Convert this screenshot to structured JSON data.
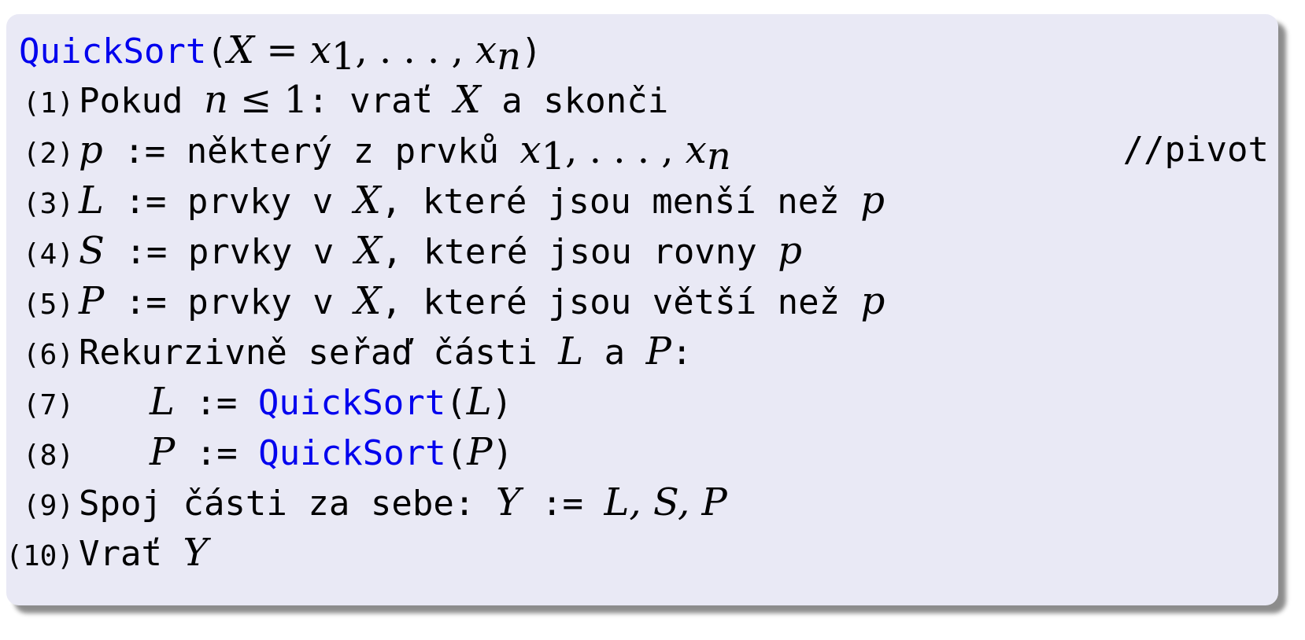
{
  "title": {
    "func": "QuickSort",
    "open": "(",
    "var_x": "X",
    "eq": " = ",
    "x": "x",
    "sub1": "1",
    "ellipsis": ", . . . , ",
    "xn": "x",
    "subn": "n",
    "close": ")"
  },
  "lines": [
    {
      "num": "(1)",
      "t1": "Pokud ",
      "m1": "n",
      "mu1": " ≤ 1",
      "t2": ": vrať ",
      "m2": "X",
      "t3": " a skonči"
    },
    {
      "num": "(2)",
      "m1": "p",
      "t1": " := některý z prvků ",
      "x": "x",
      "sub1": "1",
      "ellipsis": ", . . . , ",
      "xn": "x",
      "subn": "n",
      "comment": "//pivot"
    },
    {
      "num": "(3)",
      "m1": "L",
      "t1": " := prvky v ",
      "m2": "X",
      "t2": ", které jsou menší než ",
      "m3": "p"
    },
    {
      "num": "(4)",
      "m1": "S",
      "t1": " := prvky v ",
      "m2": "X",
      "t2": ", které jsou rovny ",
      "m3": "p"
    },
    {
      "num": "(5)",
      "m1": "P",
      "t1": " := prvky v ",
      "m2": "X",
      "t2": ", které jsou větší než ",
      "m3": "p"
    },
    {
      "num": "(6)",
      "t1": "Rekurzivně seřaď části ",
      "m1": "L",
      "t2": " a ",
      "m2": "P",
      "t3": ":"
    },
    {
      "num": "(7)",
      "m1": "L",
      "t1": " := ",
      "kw": "QuickSort",
      "open": "(",
      "m2": "L",
      "close": ")"
    },
    {
      "num": "(8)",
      "m1": "P",
      "t1": " := ",
      "kw": "QuickSort",
      "open": "(",
      "m2": "P",
      "close": ")"
    },
    {
      "num": "(9)",
      "t1": "Spoj části za sebe: ",
      "m1": "Y",
      "t2": " := ",
      "m2": "L, S, P"
    },
    {
      "num": "(10)",
      "t1": "Vrať ",
      "m1": "Y"
    }
  ]
}
